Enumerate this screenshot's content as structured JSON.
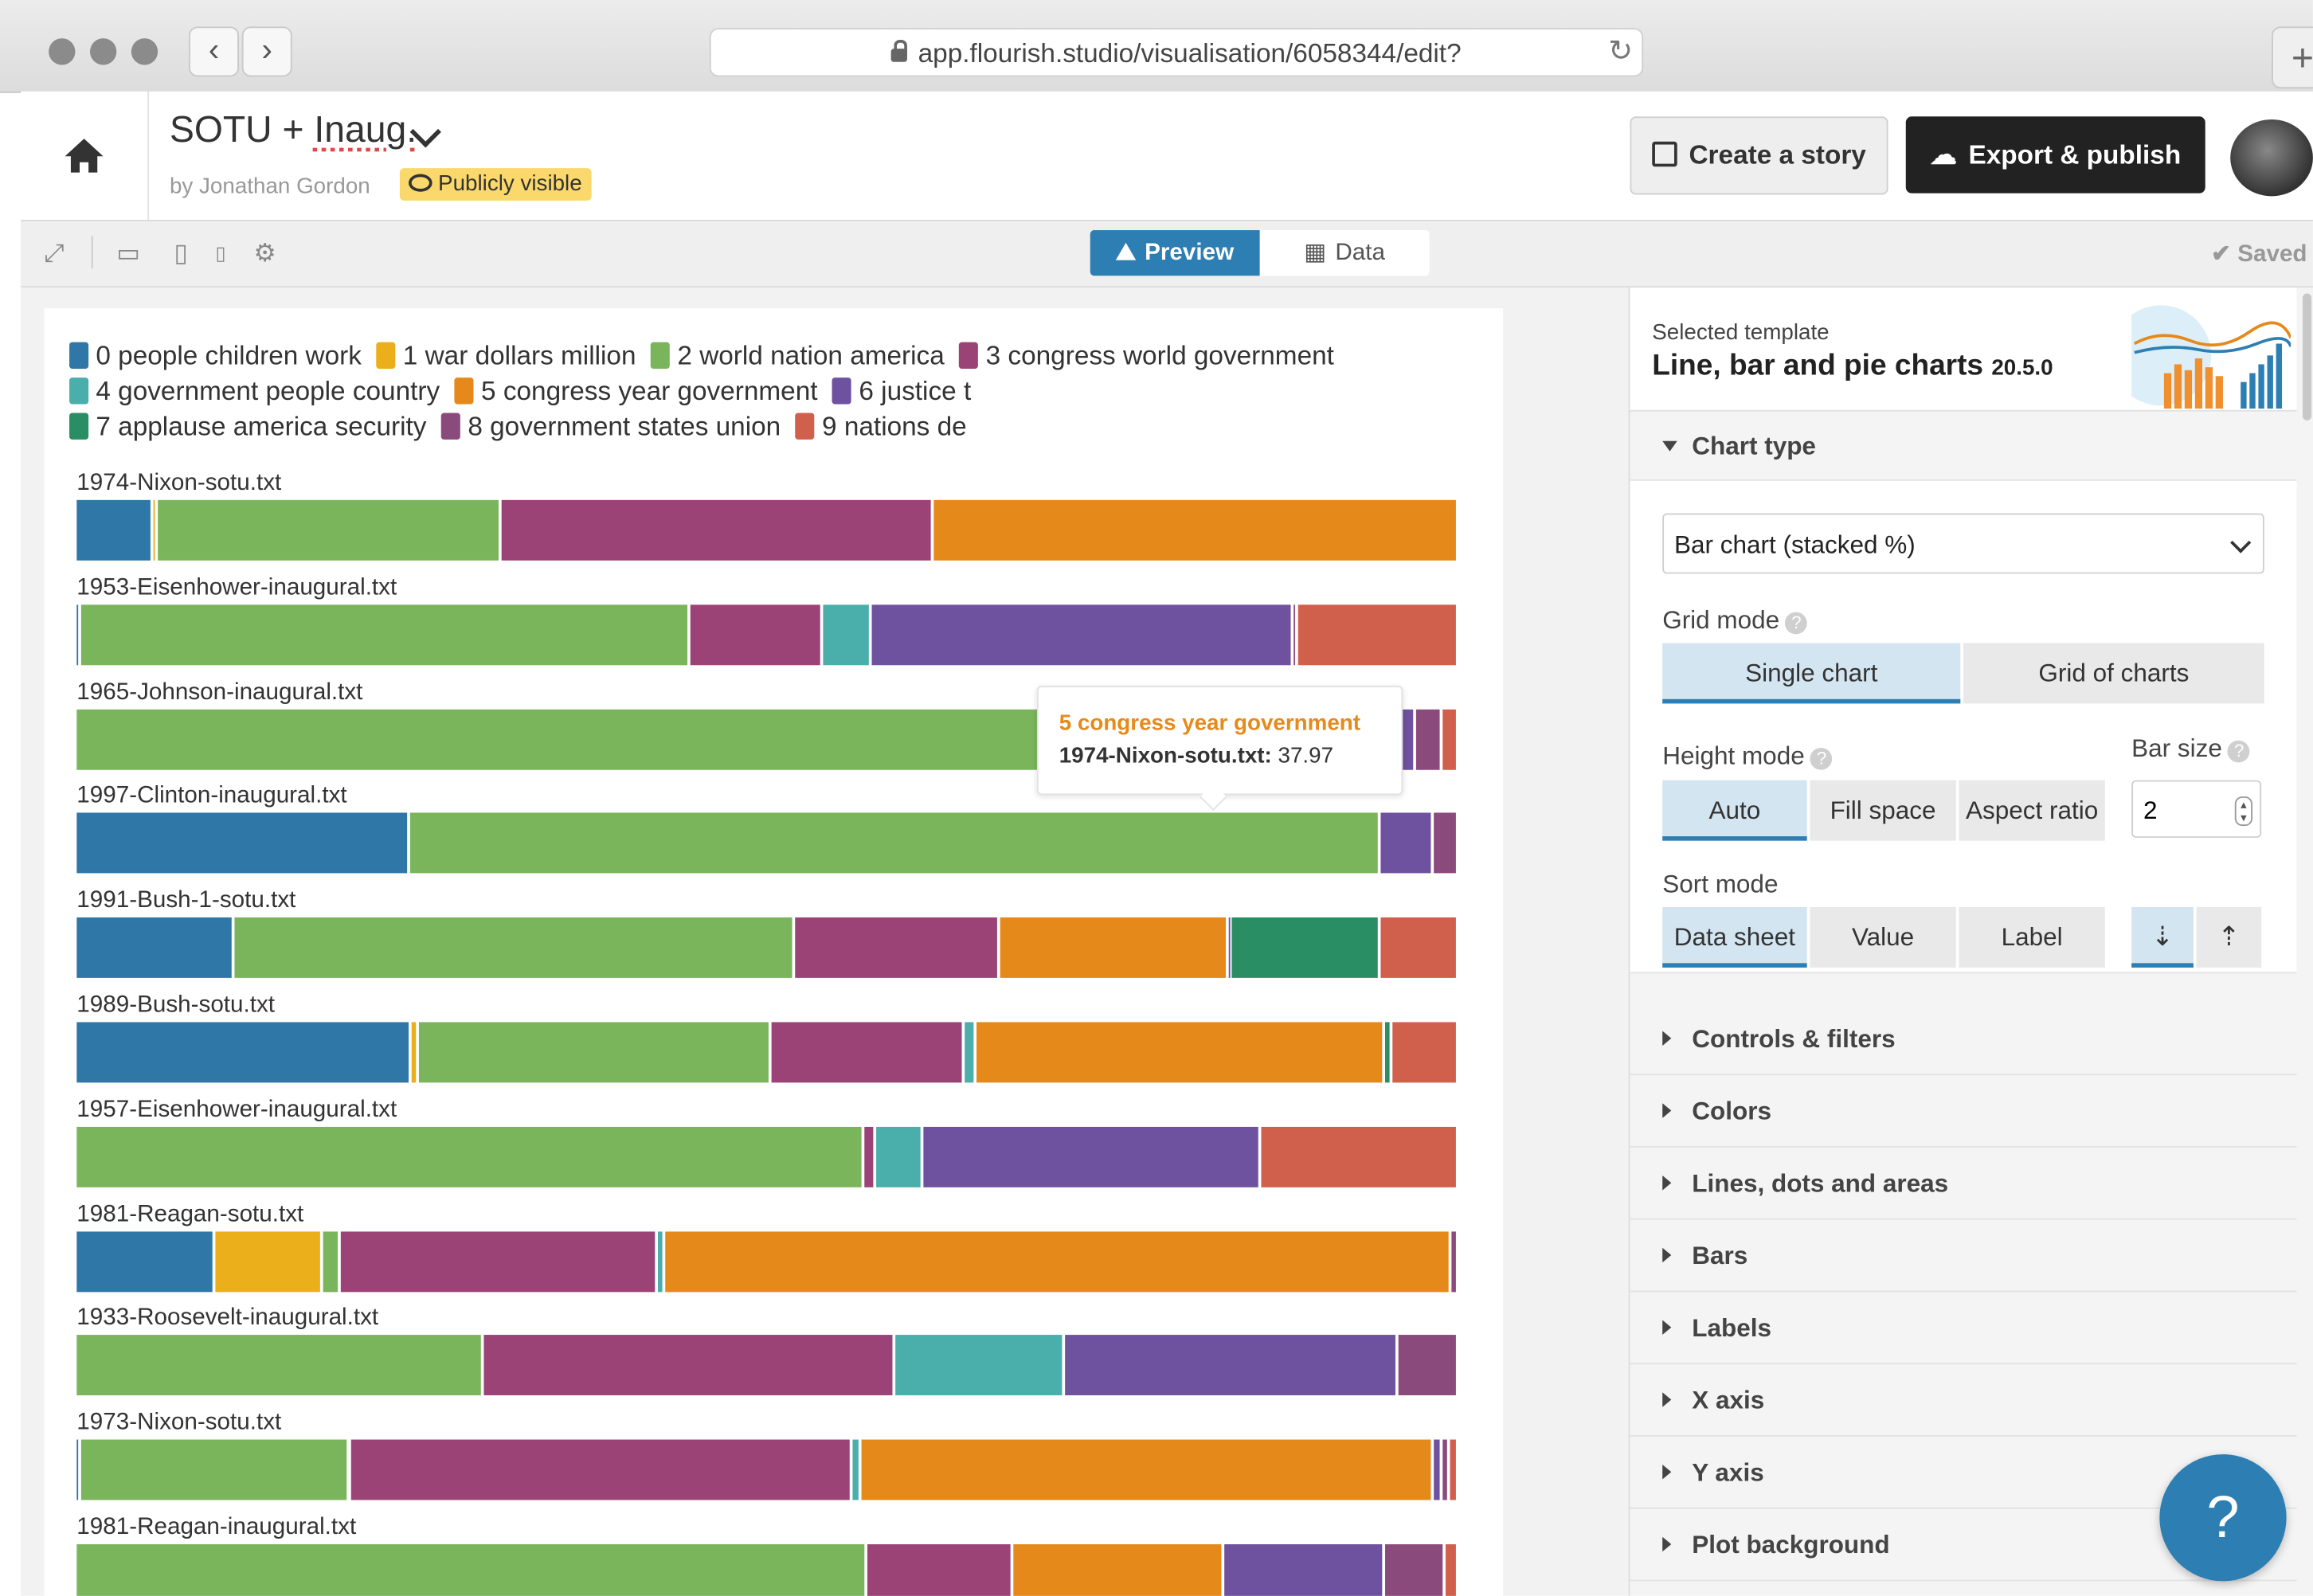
{
  "browser": {
    "url": "app.flourish.studio/visualisation/6058344/edit?"
  },
  "header": {
    "title_prefix": "SOTU + ",
    "title_suffix": "Inaug.",
    "byline": "by Jonathan Gordon",
    "visibility": "Publicly visible",
    "create_story": "Create a story",
    "export_publish": "Export & publish"
  },
  "toolbar": {
    "preview": "Preview",
    "data": "Data",
    "saved": "Saved"
  },
  "legend": [
    {
      "label": "0 people children work",
      "color": "#2f77a6"
    },
    {
      "label": "1 war dollars million",
      "color": "#ebaf1b"
    },
    {
      "label": "2 world nation america",
      "color": "#7ab55c"
    },
    {
      "label": "3 congress world government",
      "color": "#9b4377"
    },
    {
      "label": "4 government people country",
      "color": "#4aafaa"
    },
    {
      "label": "5 congress year government",
      "color": "#e6891b"
    },
    {
      "label": "6 justice t",
      "color": "#6f529f"
    },
    {
      "label": "7 applause america security",
      "color": "#2a8e64"
    },
    {
      "label": "8 government states union",
      "color": "#8b4a7c"
    },
    {
      "label": "9 nations de",
      "color": "#d05f4c"
    }
  ],
  "tooltip": {
    "title": "5 congress year government",
    "label": "1974-Nixon-sotu.txt:",
    "value": "37.97"
  },
  "chart_data": {
    "type": "bar",
    "mode": "stacked 100%",
    "series_names": [
      "0 people children work",
      "1 war dollars million",
      "2 world nation america",
      "3 congress world government",
      "4 government people country",
      "5 congress year government",
      "6 justice t",
      "7 applause america security",
      "8 government states union",
      "9 nations de"
    ],
    "rows": [
      {
        "label": "1974-Nixon-sotu.txt",
        "values": [
          5.6,
          0.3,
          24.9,
          31.3,
          0,
          37.97,
          0,
          0,
          0,
          0
        ]
      },
      {
        "label": "1953-Eisenhower-inaugural.txt",
        "values": [
          0.3,
          0,
          43.9,
          9.5,
          3.5,
          0,
          30.4,
          0,
          0.3,
          11.6
        ]
      },
      {
        "label": "1965-Johnson-inaugural.txt",
        "values": [
          0,
          0,
          77.0,
          0,
          0,
          0.5,
          19.1,
          0,
          1.9,
          1.2
        ]
      },
      {
        "label": "1997-Clinton-inaugural.txt",
        "values": [
          24.0,
          0,
          70.0,
          0,
          0,
          0,
          3.8,
          0,
          1.8,
          0
        ]
      },
      {
        "label": "1991-Bush-1-sotu.txt",
        "values": [
          11.4,
          0,
          40.3,
          14.7,
          0,
          16.4,
          0.3,
          10.7,
          0,
          5.6
        ]
      },
      {
        "label": "1989-Bush-sotu.txt",
        "values": [
          23.9,
          0.5,
          25.2,
          13.8,
          0.8,
          29.1,
          0,
          0.6,
          0,
          4.7
        ]
      },
      {
        "label": "1957-Eisenhower-inaugural.txt",
        "values": [
          0,
          0,
          56.8,
          0.8,
          3.4,
          0,
          24.4,
          0,
          0,
          14.2
        ]
      },
      {
        "label": "1981-Reagan-sotu.txt",
        "values": [
          10.0,
          7.8,
          1.3,
          22.9,
          0.6,
          56.9,
          0,
          0,
          0.5,
          0
        ]
      },
      {
        "label": "1933-Roosevelt-inaugural.txt",
        "values": [
          0,
          0,
          29.3,
          29.6,
          12.3,
          0,
          23.9,
          0,
          4.4,
          0
        ]
      },
      {
        "label": "1973-Nixon-sotu.txt",
        "values": [
          0.3,
          0,
          19.3,
          36.0,
          0.6,
          41.0,
          0.6,
          0,
          0.6,
          0.6
        ]
      },
      {
        "label": "1981-Reagan-inaugural.txt",
        "values": [
          0,
          0,
          57.2,
          10.6,
          0,
          15.2,
          11.7,
          0,
          4.3,
          1.0
        ]
      }
    ]
  },
  "panel": {
    "selected_template_label": "Selected template",
    "template_name": "Line, bar and pie charts",
    "template_version": "20.5.0",
    "chart_type_header": "Chart type",
    "chart_type_value": "Bar chart (stacked %)",
    "grid_mode_label": "Grid mode",
    "grid_single": "Single chart",
    "grid_grid": "Grid of charts",
    "height_mode_label": "Height mode",
    "height_auto": "Auto",
    "height_fill": "Fill space",
    "height_aspect": "Aspect ratio",
    "bar_size_label": "Bar size",
    "bar_size_value": "2",
    "sort_mode_label": "Sort mode",
    "sort_data": "Data sheet",
    "sort_value": "Value",
    "sort_label": "Label",
    "sections": [
      "Controls & filters",
      "Colors",
      "Lines, dots and areas",
      "Bars",
      "Labels",
      "X axis",
      "Y axis",
      "Plot background"
    ]
  },
  "help_fab": "?"
}
